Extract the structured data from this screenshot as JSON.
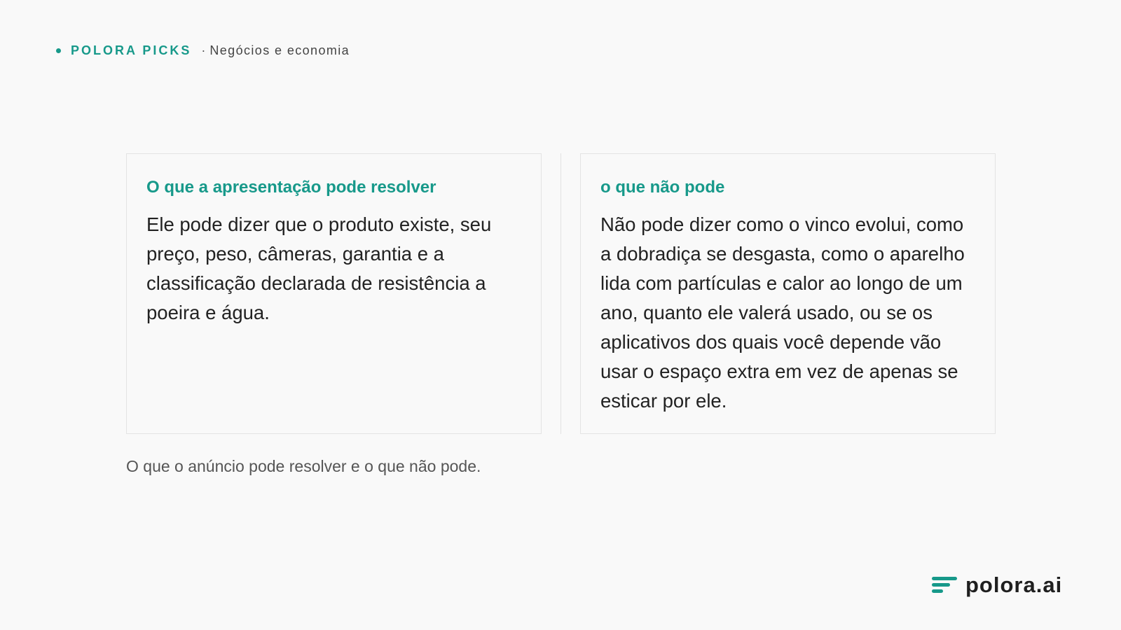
{
  "header": {
    "brand": "POLORA PICKS",
    "separator": "·",
    "category": "Negócios e economia"
  },
  "panels": {
    "left": {
      "title": "O que a apresentação pode resolver",
      "body": "Ele pode dizer que o produto existe, seu preço, peso, câmeras, garantia e a classificação declarada de resistência a poeira e água."
    },
    "right": {
      "title": "o que não pode",
      "body": "Não pode dizer como o vinco evolui, como a dobradiça se desgasta, como o aparelho lida com partículas e calor ao longo de um ano, quanto ele valerá usado, ou se os aplicativos dos quais você depende vão usar o espaço extra em vez de apenas se esticar por ele."
    }
  },
  "caption": "O que o anúncio pode resolver e o que não pode.",
  "footer": {
    "logo_text": "polora.ai",
    "logo_icon": "lines-icon"
  },
  "colors": {
    "accent": "#17998a",
    "background": "#f9f9f9",
    "text": "#222222"
  }
}
